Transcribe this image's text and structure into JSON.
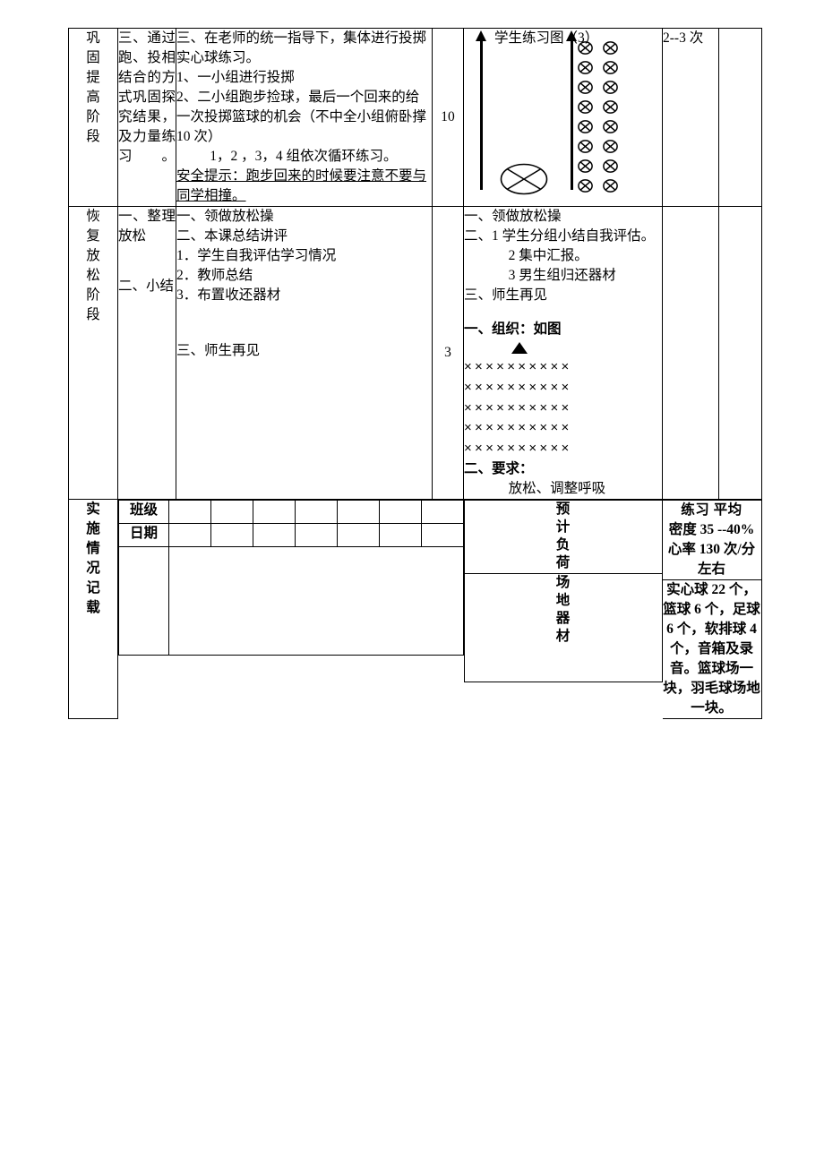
{
  "document": {
    "type": "pe-lesson-plan-table"
  },
  "rows": {
    "consolidation": {
      "stage_label": "巩固提高阶段",
      "method_lines": [
        "三、通过跑、投相结合的方式巩固探究结果，及力量练习。"
      ],
      "content": [
        "三、在老师的统一指导下，集体进行投掷实心球练习。",
        "1、一小组进行投掷",
        "2、二小组跑步捡球，最后一个回来的给一次投掷篮球的机会（不中全小组俯卧撑 10 次）",
        "1，2 ，3，4 组依次循环练习。",
        "安全提示：跑步回来的时候要注意不要与同学相撞。"
      ],
      "time": "10",
      "diagram_title": "学生练习图（3）",
      "diagram": {
        "symbol_rows": 8,
        "symbols_per_row": 2,
        "arrows": 2,
        "ellipse": 1
      },
      "reps": "2--3 次"
    },
    "recovery": {
      "stage_label": "恢复放松阶段",
      "method_lines": [
        "一、整理放松",
        "二、小结"
      ],
      "content": [
        "一、领做放松操",
        "二、本课总结讲评",
        "1．学生自我评估学习情况",
        "2．教师总结",
        "3．布置收还器材",
        "三、师生再见"
      ],
      "time": "3",
      "organization": {
        "heading": "一、组织：如图",
        "formation_rows": 5,
        "marks_per_row": 10,
        "mark_glyph": "×",
        "requirement_heading": "二、要求：",
        "requirement_text": "放松、调整呼吸"
      },
      "reps": ""
    },
    "record": {
      "stage_label": "实施情况记载",
      "class_label": "班级",
      "date_label": "日期",
      "empty_columns": 7,
      "load_label": "预计负荷",
      "density_line1": "练习        平均",
      "density_line2": "密度 35 --40%心率 130  次/分左右",
      "venue_label": "场地器材",
      "equipment_text": "实心球 22 个，篮球 6 个，足球 6 个，软排球 4 个，音箱及录音。篮球场一块，羽毛球场地一块。"
    }
  },
  "colors": {
    "border": "#000000",
    "text": "#000000",
    "background": "#ffffff"
  }
}
